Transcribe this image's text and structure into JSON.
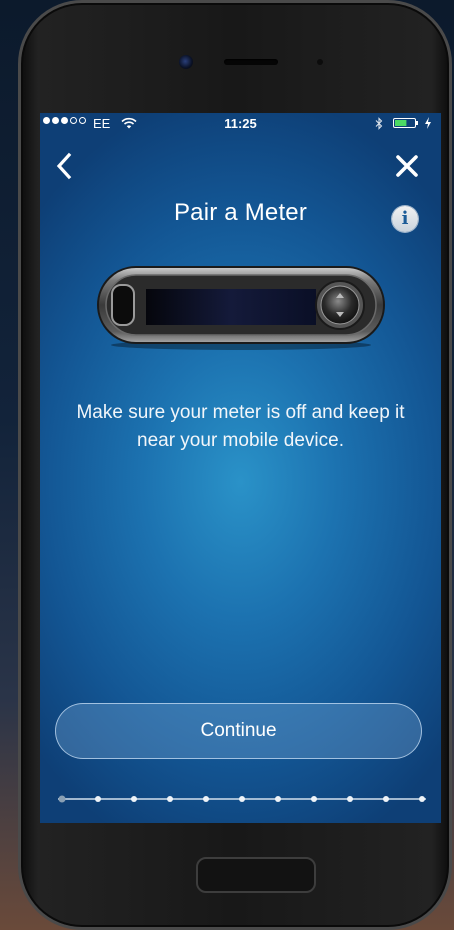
{
  "status_bar": {
    "signal_full": 3,
    "signal_empty": 2,
    "carrier": "EE",
    "time": "11:25",
    "icons": [
      "wifi-icon",
      "bluetooth-icon",
      "battery-icon",
      "charging-icon"
    ],
    "battery_level": 0.6,
    "battery_color": "#4cd964"
  },
  "nav": {
    "back_icon": "chevron-left-icon",
    "close_icon": "close-icon"
  },
  "title": "Pair a Meter",
  "info_label": "i",
  "instruction": "Make sure your meter is off and keep it near your mobile device.",
  "continue_label": "Continue",
  "progress": {
    "total_steps": 11,
    "current_step": 1
  },
  "colors": {
    "screen_background": "#1c72b0",
    "button_border": "#d2e6fa",
    "text": "#ffffff"
  }
}
